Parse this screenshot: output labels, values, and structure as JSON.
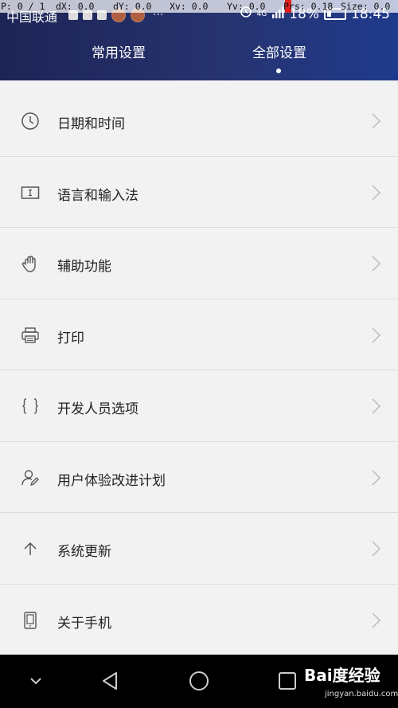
{
  "debug": {
    "items": [
      "P: 0 / 1",
      "dX: 0.0",
      "dY: 0.0",
      "Xv: 0.0",
      "Yv: 0.0",
      "Prs: 0.18",
      "Size: 0.0"
    ]
  },
  "statusbar": {
    "carrier": "中国联通",
    "battery": "18%",
    "time": "18:45",
    "network": "4G"
  },
  "tabs": [
    {
      "label": "常用设置"
    },
    {
      "label": "全部设置"
    }
  ],
  "settings": {
    "items": [
      {
        "label": "日期和时间",
        "icon": "clock-icon"
      },
      {
        "label": "语言和输入法",
        "icon": "keyboard-icon"
      },
      {
        "label": "辅助功能",
        "icon": "hand-icon"
      },
      {
        "label": "打印",
        "icon": "printer-icon"
      },
      {
        "label": "开发人员选项",
        "icon": "braces-icon"
      },
      {
        "label": "用户体验改进计划",
        "icon": "user-edit-icon"
      },
      {
        "label": "系统更新",
        "icon": "arrow-up-icon"
      },
      {
        "label": "关于手机",
        "icon": "phone-icon"
      }
    ]
  },
  "watermark": {
    "brand": "Bai度经验",
    "url": "jingyan.baidu.com"
  }
}
